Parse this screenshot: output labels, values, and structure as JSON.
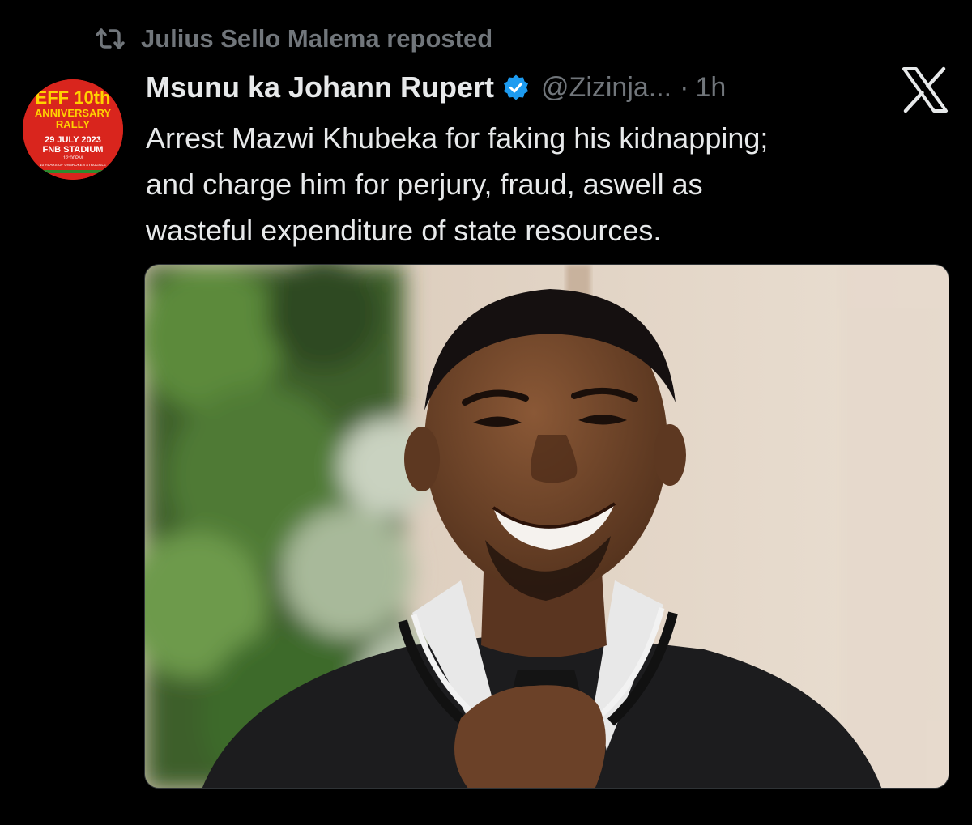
{
  "repost": {
    "icon": "repost-icon",
    "text": "Julius Sello Malema reposted"
  },
  "author": {
    "display_name": "Msunu ka Johann Rupert",
    "verified_icon": "verified-badge-icon",
    "handle": "@Zizinja...",
    "separator": "·",
    "time": "1h"
  },
  "avatar": {
    "line1": "EFF 10th",
    "line2": "ANNIVERSARY",
    "line3": "RALLY",
    "line4": "29 JULY 2023",
    "line5": "FNB STADIUM",
    "line6": "12:00PM",
    "line7": "10 YEARS OF UNBROKEN STRUGGLE"
  },
  "brand_icon": "x-logo-icon",
  "tweet": {
    "lines": [
      "Arrest Mazwi Khubeka for faking his kidnapping;",
      "and charge him for perjury, fraud, aswell as",
      "wasteful expenditure of state resources."
    ]
  },
  "media": {
    "type": "photo"
  },
  "colors": {
    "background": "#000000",
    "text_primary": "#e7e9ea",
    "text_secondary": "#71767b",
    "verified_blue": "#1d9bf0",
    "avatar_red": "#d9251d",
    "avatar_yellow": "#ffd200"
  }
}
